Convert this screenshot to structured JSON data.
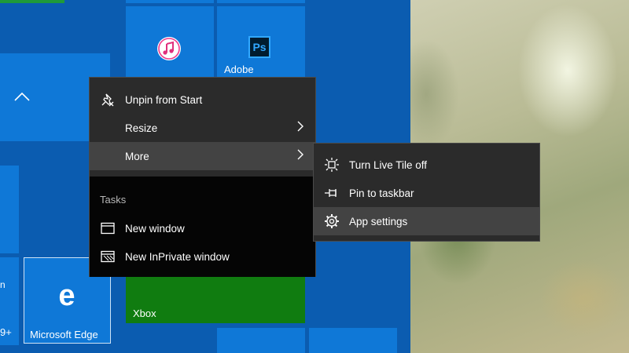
{
  "tiles": {
    "adobe_label": "Adobe",
    "xbox_label": "Xbox",
    "edge_label": "Microsoft Edge",
    "edge_glyph": "e",
    "photoshop_glyph": "Ps",
    "partial_label": "9+",
    "partial_letter": "n",
    "collapse_icon": "chevron-up-icon"
  },
  "context_menu": {
    "unpin_label": "Unpin from Start",
    "resize_label": "Resize",
    "more_label": "More",
    "tasks_heading": "Tasks",
    "new_window_label": "New window",
    "new_inprivate_label": "New InPrivate window"
  },
  "submenu": {
    "live_tile_label": "Turn Live Tile off",
    "pin_taskbar_label": "Pin to taskbar",
    "app_settings_label": "App settings"
  },
  "colors": {
    "start_bg": "#0b5cb0",
    "tile": "#0f78d7",
    "xbox": "#107c10",
    "menu_bg": "#2b2b2b",
    "menu_highlight": "#434343"
  }
}
